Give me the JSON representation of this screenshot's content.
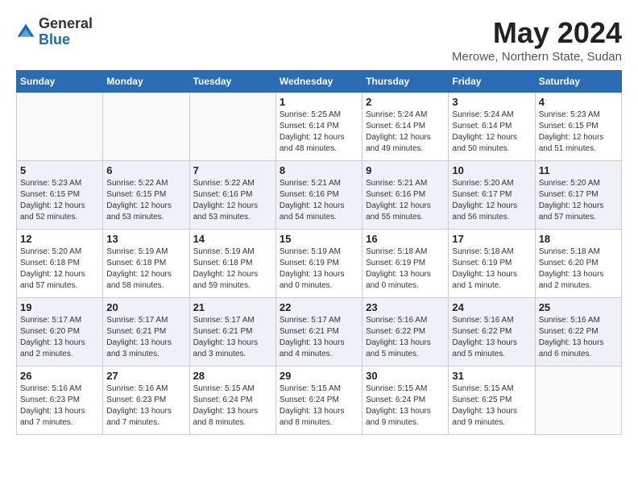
{
  "logo": {
    "general": "General",
    "blue": "Blue"
  },
  "header": {
    "month_year": "May 2024",
    "location": "Merowe, Northern State, Sudan"
  },
  "days_of_week": [
    "Sunday",
    "Monday",
    "Tuesday",
    "Wednesday",
    "Thursday",
    "Friday",
    "Saturday"
  ],
  "weeks": [
    [
      {
        "day": "",
        "info": ""
      },
      {
        "day": "",
        "info": ""
      },
      {
        "day": "",
        "info": ""
      },
      {
        "day": "1",
        "info": "Sunrise: 5:25 AM\nSunset: 6:14 PM\nDaylight: 12 hours\nand 48 minutes."
      },
      {
        "day": "2",
        "info": "Sunrise: 5:24 AM\nSunset: 6:14 PM\nDaylight: 12 hours\nand 49 minutes."
      },
      {
        "day": "3",
        "info": "Sunrise: 5:24 AM\nSunset: 6:14 PM\nDaylight: 12 hours\nand 50 minutes."
      },
      {
        "day": "4",
        "info": "Sunrise: 5:23 AM\nSunset: 6:15 PM\nDaylight: 12 hours\nand 51 minutes."
      }
    ],
    [
      {
        "day": "5",
        "info": "Sunrise: 5:23 AM\nSunset: 6:15 PM\nDaylight: 12 hours\nand 52 minutes."
      },
      {
        "day": "6",
        "info": "Sunrise: 5:22 AM\nSunset: 6:15 PM\nDaylight: 12 hours\nand 53 minutes."
      },
      {
        "day": "7",
        "info": "Sunrise: 5:22 AM\nSunset: 6:16 PM\nDaylight: 12 hours\nand 53 minutes."
      },
      {
        "day": "8",
        "info": "Sunrise: 5:21 AM\nSunset: 6:16 PM\nDaylight: 12 hours\nand 54 minutes."
      },
      {
        "day": "9",
        "info": "Sunrise: 5:21 AM\nSunset: 6:16 PM\nDaylight: 12 hours\nand 55 minutes."
      },
      {
        "day": "10",
        "info": "Sunrise: 5:20 AM\nSunset: 6:17 PM\nDaylight: 12 hours\nand 56 minutes."
      },
      {
        "day": "11",
        "info": "Sunrise: 5:20 AM\nSunset: 6:17 PM\nDaylight: 12 hours\nand 57 minutes."
      }
    ],
    [
      {
        "day": "12",
        "info": "Sunrise: 5:20 AM\nSunset: 6:18 PM\nDaylight: 12 hours\nand 57 minutes."
      },
      {
        "day": "13",
        "info": "Sunrise: 5:19 AM\nSunset: 6:18 PM\nDaylight: 12 hours\nand 58 minutes."
      },
      {
        "day": "14",
        "info": "Sunrise: 5:19 AM\nSunset: 6:18 PM\nDaylight: 12 hours\nand 59 minutes."
      },
      {
        "day": "15",
        "info": "Sunrise: 5:19 AM\nSunset: 6:19 PM\nDaylight: 13 hours\nand 0 minutes."
      },
      {
        "day": "16",
        "info": "Sunrise: 5:18 AM\nSunset: 6:19 PM\nDaylight: 13 hours\nand 0 minutes."
      },
      {
        "day": "17",
        "info": "Sunrise: 5:18 AM\nSunset: 6:19 PM\nDaylight: 13 hours\nand 1 minute."
      },
      {
        "day": "18",
        "info": "Sunrise: 5:18 AM\nSunset: 6:20 PM\nDaylight: 13 hours\nand 2 minutes."
      }
    ],
    [
      {
        "day": "19",
        "info": "Sunrise: 5:17 AM\nSunset: 6:20 PM\nDaylight: 13 hours\nand 2 minutes."
      },
      {
        "day": "20",
        "info": "Sunrise: 5:17 AM\nSunset: 6:21 PM\nDaylight: 13 hours\nand 3 minutes."
      },
      {
        "day": "21",
        "info": "Sunrise: 5:17 AM\nSunset: 6:21 PM\nDaylight: 13 hours\nand 3 minutes."
      },
      {
        "day": "22",
        "info": "Sunrise: 5:17 AM\nSunset: 6:21 PM\nDaylight: 13 hours\nand 4 minutes."
      },
      {
        "day": "23",
        "info": "Sunrise: 5:16 AM\nSunset: 6:22 PM\nDaylight: 13 hours\nand 5 minutes."
      },
      {
        "day": "24",
        "info": "Sunrise: 5:16 AM\nSunset: 6:22 PM\nDaylight: 13 hours\nand 5 minutes."
      },
      {
        "day": "25",
        "info": "Sunrise: 5:16 AM\nSunset: 6:22 PM\nDaylight: 13 hours\nand 6 minutes."
      }
    ],
    [
      {
        "day": "26",
        "info": "Sunrise: 5:16 AM\nSunset: 6:23 PM\nDaylight: 13 hours\nand 7 minutes."
      },
      {
        "day": "27",
        "info": "Sunrise: 5:16 AM\nSunset: 6:23 PM\nDaylight: 13 hours\nand 7 minutes."
      },
      {
        "day": "28",
        "info": "Sunrise: 5:15 AM\nSunset: 6:24 PM\nDaylight: 13 hours\nand 8 minutes."
      },
      {
        "day": "29",
        "info": "Sunrise: 5:15 AM\nSunset: 6:24 PM\nDaylight: 13 hours\nand 8 minutes."
      },
      {
        "day": "30",
        "info": "Sunrise: 5:15 AM\nSunset: 6:24 PM\nDaylight: 13 hours\nand 9 minutes."
      },
      {
        "day": "31",
        "info": "Sunrise: 5:15 AM\nSunset: 6:25 PM\nDaylight: 13 hours\nand 9 minutes."
      },
      {
        "day": "",
        "info": ""
      }
    ]
  ]
}
